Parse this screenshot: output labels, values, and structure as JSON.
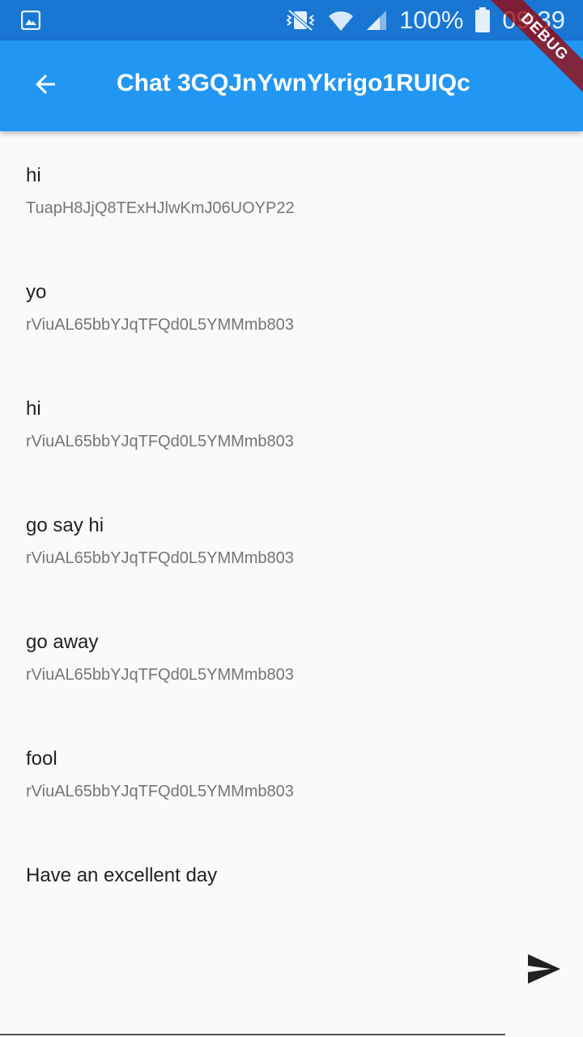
{
  "status_bar": {
    "battery": "100%",
    "time": "09:39",
    "icons": [
      "image-icon",
      "vibrate-mute-icon",
      "wifi-icon",
      "signal-icon",
      "battery-icon"
    ]
  },
  "debug_banner": "DEBUG",
  "app_bar": {
    "back_icon": "arrow-back-icon",
    "title": "Chat 3GQJnYwnYkrigo1RUIQc"
  },
  "messages": [
    {
      "text": "hi",
      "sender": "TuapH8JjQ8TExHJlwKmJ06UOYP22"
    },
    {
      "text": "yo",
      "sender": "rViuAL65bbYJqTFQd0L5YMMmb803"
    },
    {
      "text": "hi",
      "sender": "rViuAL65bbYJqTFQd0L5YMMmb803"
    },
    {
      "text": "go say hi",
      "sender": "rViuAL65bbYJqTFQd0L5YMMmb803"
    },
    {
      "text": "go away",
      "sender": "rViuAL65bbYJqTFQd0L5YMMmb803"
    },
    {
      "text": "fool",
      "sender": "rViuAL65bbYJqTFQd0L5YMMmb803"
    },
    {
      "text": "Have an excellent day",
      "sender": ""
    }
  ],
  "composer": {
    "value": "",
    "placeholder": "",
    "send_icon": "send-icon"
  },
  "colors": {
    "status_bar": "#1976d2",
    "app_bar": "#2196f3",
    "background": "#fafafa",
    "message_text": "#212121",
    "sender_text": "#757575"
  }
}
